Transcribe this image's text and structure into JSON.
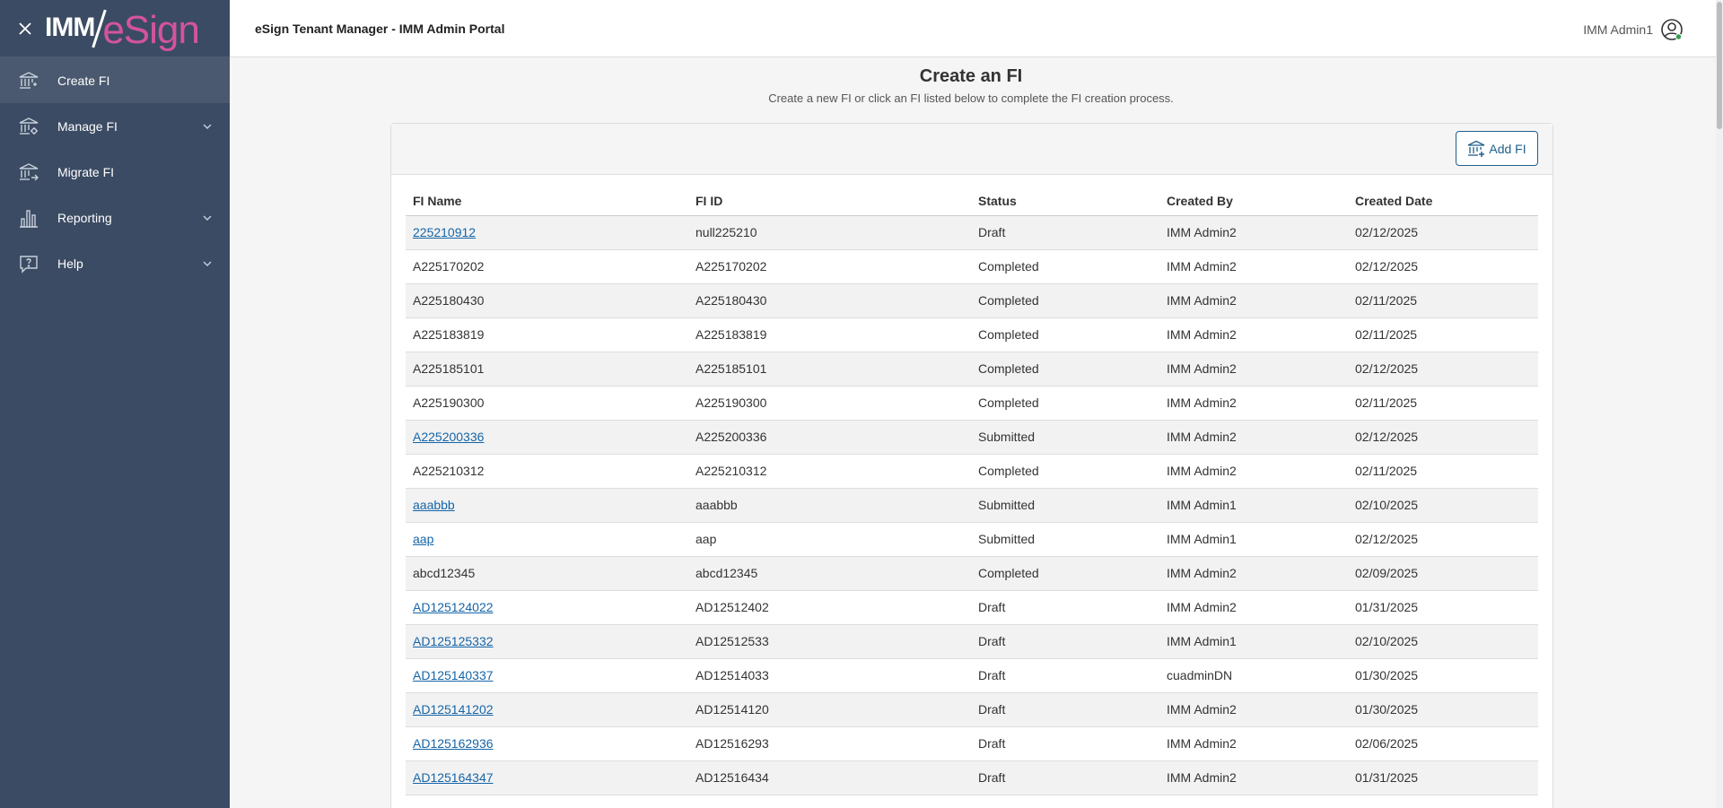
{
  "app": {
    "logo_text_1": "IMM",
    "logo_text_2": "eSign",
    "header_title": "eSign Tenant Manager - IMM Admin Portal",
    "user_name": "IMM Admin1"
  },
  "sidebar": {
    "items": [
      {
        "label": "Create FI",
        "icon": "bank-icon",
        "has_chevron": false,
        "active": true
      },
      {
        "label": "Manage FI",
        "icon": "bank-settings-icon",
        "has_chevron": true,
        "active": false
      },
      {
        "label": "Migrate FI",
        "icon": "bank-migrate-icon",
        "has_chevron": false,
        "active": false
      },
      {
        "label": "Reporting",
        "icon": "bar-chart-icon",
        "has_chevron": true,
        "active": false
      },
      {
        "label": "Help",
        "icon": "help-icon",
        "has_chevron": true,
        "active": false
      }
    ]
  },
  "main": {
    "title": "Create an FI",
    "subtitle": "Create a new FI or click an FI listed below to complete the FI creation process.",
    "add_button_label": "Add FI"
  },
  "table": {
    "headers": [
      "FI Name",
      "FI ID",
      "Status",
      "Created By",
      "Created Date"
    ],
    "rows": [
      {
        "name": "225210912",
        "link": true,
        "id": "null225210",
        "status": "Draft",
        "created_by": "IMM Admin2",
        "date": "02/12/2025"
      },
      {
        "name": "A225170202",
        "link": false,
        "id": "A225170202",
        "status": "Completed",
        "created_by": "IMM Admin2",
        "date": "02/12/2025"
      },
      {
        "name": "A225180430",
        "link": false,
        "id": "A225180430",
        "status": "Completed",
        "created_by": "IMM Admin2",
        "date": "02/11/2025"
      },
      {
        "name": "A225183819",
        "link": false,
        "id": "A225183819",
        "status": "Completed",
        "created_by": "IMM Admin2",
        "date": "02/11/2025"
      },
      {
        "name": "A225185101",
        "link": false,
        "id": "A225185101",
        "status": "Completed",
        "created_by": "IMM Admin2",
        "date": "02/12/2025"
      },
      {
        "name": "A225190300",
        "link": false,
        "id": "A225190300",
        "status": "Completed",
        "created_by": "IMM Admin2",
        "date": "02/11/2025"
      },
      {
        "name": "A225200336",
        "link": true,
        "id": "A225200336",
        "status": "Submitted",
        "created_by": "IMM Admin2",
        "date": "02/12/2025"
      },
      {
        "name": "A225210312",
        "link": false,
        "id": "A225210312",
        "status": "Completed",
        "created_by": "IMM Admin2",
        "date": "02/11/2025"
      },
      {
        "name": "aaabbb",
        "link": true,
        "id": "aaabbb",
        "status": "Submitted",
        "created_by": "IMM Admin1",
        "date": "02/10/2025"
      },
      {
        "name": "aap",
        "link": true,
        "id": "aap",
        "status": "Submitted",
        "created_by": "IMM Admin1",
        "date": "02/12/2025"
      },
      {
        "name": "abcd12345",
        "link": false,
        "id": "abcd12345",
        "status": "Completed",
        "created_by": "IMM Admin2",
        "date": "02/09/2025"
      },
      {
        "name": "AD125124022",
        "link": true,
        "id": "AD12512402",
        "status": "Draft",
        "created_by": "IMM Admin2",
        "date": "01/31/2025"
      },
      {
        "name": "AD125125332",
        "link": true,
        "id": "AD12512533",
        "status": "Draft",
        "created_by": "IMM Admin1",
        "date": "02/10/2025"
      },
      {
        "name": "AD125140337",
        "link": true,
        "id": "AD12514033",
        "status": "Draft",
        "created_by": "cuadminDN",
        "date": "01/30/2025"
      },
      {
        "name": "AD125141202",
        "link": true,
        "id": "AD12514120",
        "status": "Draft",
        "created_by": "IMM Admin2",
        "date": "01/30/2025"
      },
      {
        "name": "AD125162936",
        "link": true,
        "id": "AD12516293",
        "status": "Draft",
        "created_by": "IMM Admin2",
        "date": "02/06/2025"
      },
      {
        "name": "AD125164347",
        "link": true,
        "id": "AD12516434",
        "status": "Draft",
        "created_by": "IMM Admin2",
        "date": "01/31/2025"
      }
    ]
  }
}
